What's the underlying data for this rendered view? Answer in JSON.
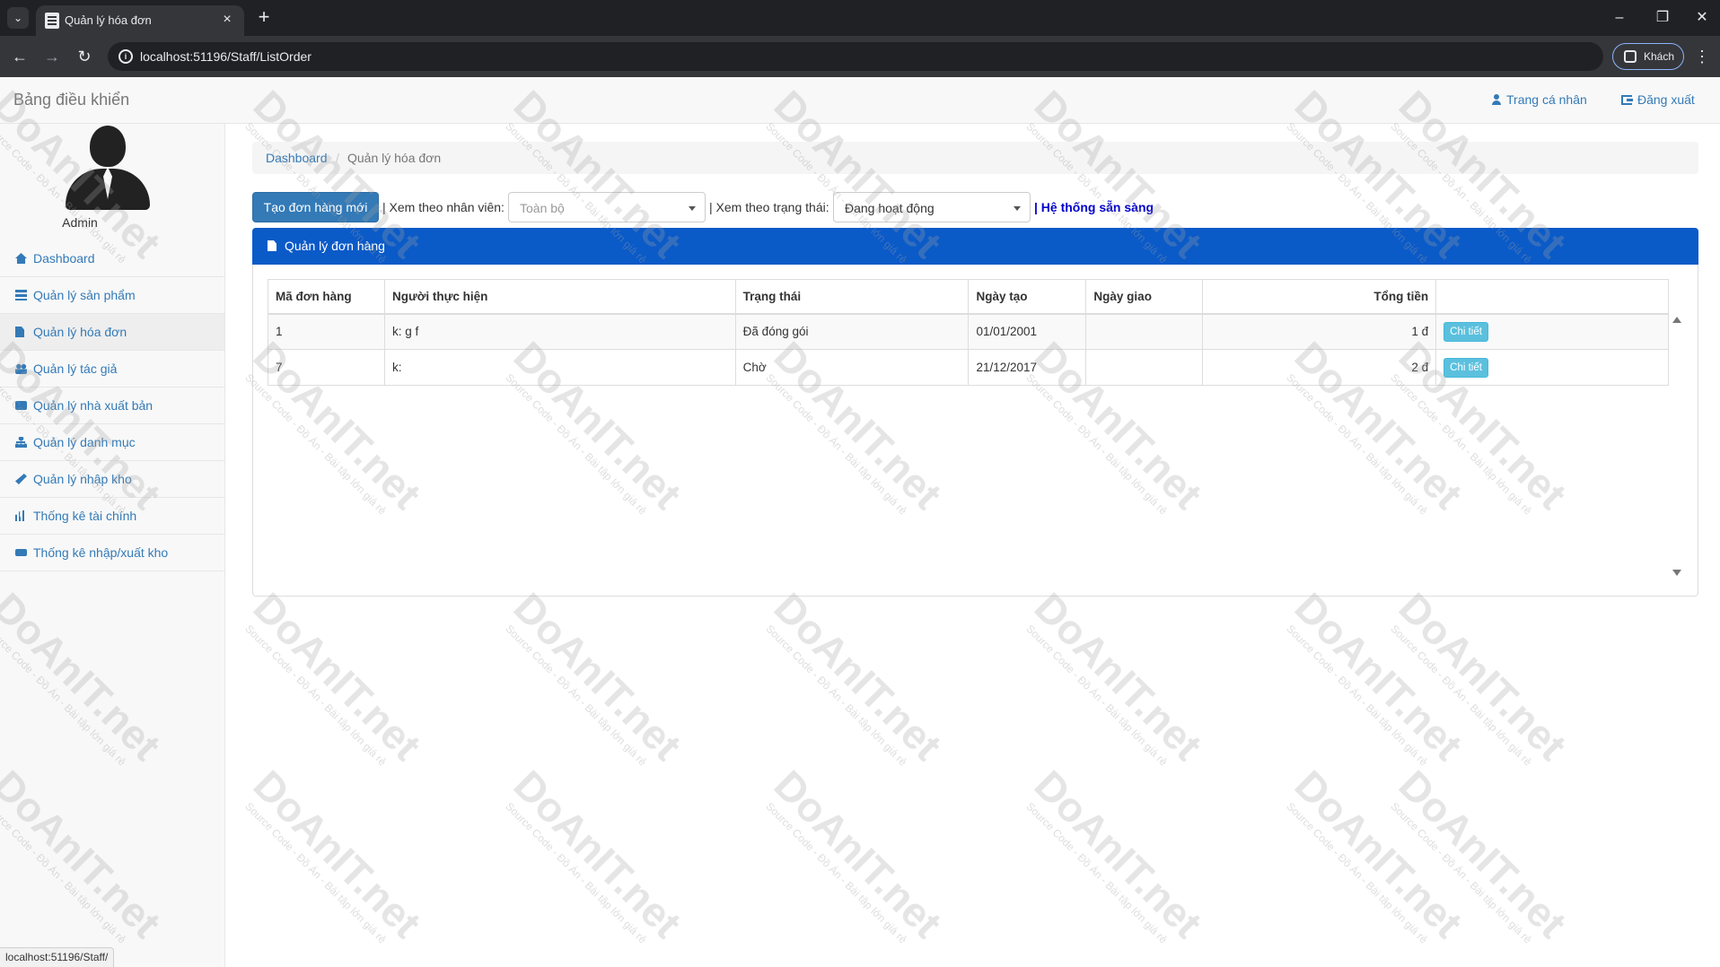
{
  "browser": {
    "tab_title": "Quản lý hóa đơn",
    "url": "localhost:51196/Staff/ListOrder",
    "profile_label": "Khách",
    "status_url": "localhost:51196/Staff/"
  },
  "navbar": {
    "brand": "Bảng điều khiển",
    "profile_link": "Trang cá nhân",
    "logout_link": "Đăng xuất"
  },
  "sidebar": {
    "admin_name": "Admin",
    "items": [
      {
        "label": "Dashboard",
        "icon": "home-icon"
      },
      {
        "label": "Quản lý sản phẩm",
        "icon": "list-icon"
      },
      {
        "label": "Quản lý hóa đơn",
        "icon": "file-icon",
        "active": true
      },
      {
        "label": "Quản lý tác giả",
        "icon": "users-icon"
      },
      {
        "label": "Quản lý nhà xuất bản",
        "icon": "briefcase-icon"
      },
      {
        "label": "Quản lý danh mục",
        "icon": "sitemap-icon"
      },
      {
        "label": "Quản lý nhập kho",
        "icon": "wrench-icon"
      },
      {
        "label": "Thống kê tài chính",
        "icon": "bar-chart-icon"
      },
      {
        "label": "Thống kê nhập/xuất kho",
        "icon": "truck-icon"
      }
    ]
  },
  "breadcrumb": {
    "home": "Dashboard",
    "separator": "/",
    "current": "Quản lý hóa đơn"
  },
  "toolbar": {
    "create_button": "Tạo đơn hàng mới",
    "filter_staff_label": "| Xem theo nhân viên:",
    "filter_staff_value": "Toàn bộ",
    "filter_status_label": "| Xem theo trạng thái:",
    "filter_status_value": "Đang hoạt động",
    "system_status": "| Hệ thống sẵn sàng"
  },
  "panel": {
    "title": "Quản lý đơn hàng"
  },
  "table": {
    "headers": [
      "Mã đơn hàng",
      "Người thực hiện",
      "Trạng thái",
      "Ngày tạo",
      "Ngày giao",
      "Tổng tiền",
      ""
    ],
    "rows": [
      [
        "1",
        "k: g f",
        "Đã đóng gói",
        "01/01/2001",
        "",
        "1 đ",
        "Chi tiết"
      ],
      [
        "7",
        "k:",
        "Chờ",
        "21/12/2017",
        "",
        "2 đ",
        "Chi tiết"
      ]
    ]
  },
  "watermark": {
    "text": "DoAnIT.net",
    "sub": "Source Code - Đồ Án - Bài tập lớn giá rẻ"
  }
}
